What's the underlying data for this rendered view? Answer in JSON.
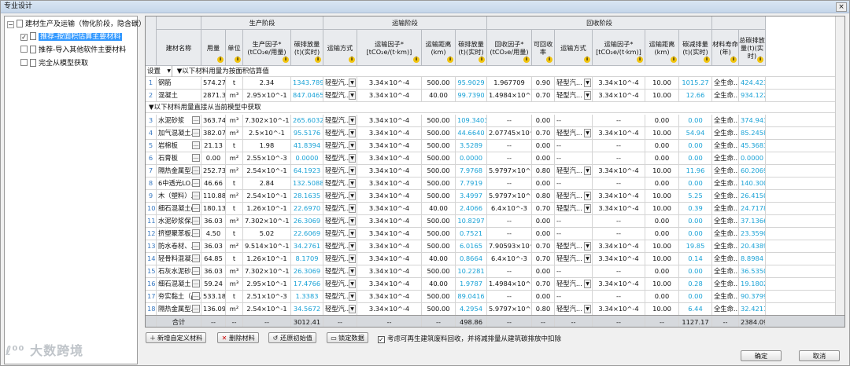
{
  "window": {
    "title": "专业设计",
    "close": "×"
  },
  "tree": {
    "root": "建材生产及运输（物化阶段，隐含碳）",
    "items": [
      {
        "label": "推荐-按面积估算主要材料",
        "checked": true,
        "selected": true
      },
      {
        "label": "推荐-导入其他软件主要材料",
        "checked": false,
        "selected": false
      },
      {
        "label": "完全从模型获取",
        "checked": false,
        "selected": false
      }
    ]
  },
  "header": {
    "groups": {
      "production": "生产阶段",
      "transport": "运输阶段",
      "recycle": "回收阶段"
    },
    "columns": [
      "建材名称",
      "用量",
      "单位",
      "生产因子*(tCO₂e/用量)",
      "碳排放量(t)(实时)",
      "运输方式",
      "运输因子*[tCO₂e/(t·km)]",
      "运输距离(km)",
      "碳排放量(t)(实时)",
      "回收因子*(tCO₂e/用量)",
      "可回收率",
      "运输方式",
      "运输因子*[tCO₂e/(t·km)]",
      "运输距离(km)",
      "碳减排量(t)(实时)",
      "材料寿命(年)",
      "总碳排放量(t)(实时)"
    ]
  },
  "group1": {
    "settings": "设置",
    "label": "以下材料用量为按面积估算值"
  },
  "group2": {
    "label": "以下材料用量直接从当前模型中获取"
  },
  "rows": [
    [
      "1",
      "钢筋",
      "574.27",
      "t",
      "2.34",
      "1343.7890",
      "轻型汽...",
      "3.34×10^-4",
      "500.00",
      "95.9029",
      "1.967709",
      "0.90",
      "轻型汽...",
      "3.34×10^-4",
      "10.00",
      "1015.27",
      "全生命...",
      "424.4234"
    ],
    [
      "2",
      "混凝土",
      "2871.34",
      "m³",
      "2.95×10^-1",
      "847.0465",
      "轻型汽...",
      "3.34×10^-4",
      "40.00",
      "99.7390",
      "1.4984×10^-2",
      "0.70",
      "轻型汽...",
      "3.34×10^-4",
      "10.00",
      "12.66",
      "全生命...",
      "934.1226"
    ],
    [
      "3",
      "水泥砂浆",
      "363.74",
      "m³",
      "7.302×10^-1",
      "265.6032",
      "轻型汽...",
      "3.34×10^-4",
      "500.00",
      "109.3403",
      "--",
      "0.00",
      "--",
      "--",
      "0.00",
      "0.00",
      "全生命...",
      "374.9435"
    ],
    [
      "4",
      "加气混凝土...",
      "382.07",
      "m³",
      "2.5×10^-1",
      "95.5176",
      "轻型汽...",
      "3.34×10^-4",
      "500.00",
      "44.6640",
      "2.07745×10^-1",
      "0.70",
      "轻型汽...",
      "3.34×10^-4",
      "10.00",
      "54.94",
      "全生命...",
      "85.2458"
    ],
    [
      "5",
      "岩棉板",
      "21.13",
      "t",
      "1.98",
      "41.8394",
      "轻型汽...",
      "3.34×10^-4",
      "500.00",
      "3.5289",
      "--",
      "0.00",
      "--",
      "--",
      "0.00",
      "0.00",
      "全生命...",
      "45.3683"
    ],
    [
      "6",
      "石膏板",
      "0.00",
      "m²",
      "2.55×10^-3",
      "0.0000",
      "轻型汽...",
      "3.34×10^-4",
      "500.00",
      "0.0000",
      "--",
      "0.00",
      "--",
      "--",
      "0.00",
      "0.00",
      "全生命...",
      "0.0000"
    ],
    [
      "7",
      "隔热金属型...",
      "252.73",
      "m²",
      "2.54×10^-1",
      "64.1923",
      "轻型汽...",
      "3.34×10^-4",
      "500.00",
      "7.9768",
      "5.9797×10^-2",
      "0.80",
      "轻型汽...",
      "3.34×10^-4",
      "10.00",
      "11.96",
      "全生命...",
      "60.2069"
    ],
    [
      "8",
      "6中透光LO...",
      "46.66",
      "t",
      "2.84",
      "132.5088",
      "轻型汽...",
      "3.34×10^-4",
      "500.00",
      "7.7919",
      "--",
      "0.00",
      "--",
      "--",
      "0.00",
      "0.00",
      "全生命...",
      "140.3006"
    ],
    [
      "9",
      "木（塑料）...",
      "110.88",
      "m²",
      "2.54×10^-1",
      "28.1635",
      "轻型汽...",
      "3.34×10^-4",
      "500.00",
      "3.4997",
      "5.9797×10^-2",
      "0.80",
      "轻型汽...",
      "3.34×10^-4",
      "10.00",
      "5.25",
      "全生命...",
      "26.4150"
    ],
    [
      "10",
      "细石混凝土(...",
      "180.13",
      "t",
      "1.26×10^-1",
      "22.6970",
      "轻型汽...",
      "3.34×10^-4",
      "40.00",
      "2.4066",
      "6.4×10^-3",
      "0.70",
      "轻型汽...",
      "3.34×10^-4",
      "10.00",
      "0.39",
      "全生命...",
      "24.7178"
    ],
    [
      "11",
      "水泥砂浆保...",
      "36.03",
      "m³",
      "7.302×10^-1",
      "26.3069",
      "轻型汽...",
      "3.34×10^-4",
      "500.00",
      "10.8297",
      "--",
      "0.00",
      "--",
      "--",
      "0.00",
      "0.00",
      "全生命...",
      "37.1366"
    ],
    [
      "12",
      "挤塑聚苯板...",
      "4.50",
      "t",
      "5.02",
      "22.6069",
      "轻型汽...",
      "3.34×10^-4",
      "500.00",
      "0.7521",
      "--",
      "0.00",
      "--",
      "--",
      "0.00",
      "0.00",
      "全生命...",
      "23.3590"
    ],
    [
      "13",
      "防水卷材、...",
      "36.03",
      "m²",
      "9.514×10^-1",
      "34.2761",
      "轻型汽...",
      "3.34×10^-4",
      "500.00",
      "6.0165",
      "7.90593×10^-1",
      "0.70",
      "轻型汽...",
      "3.34×10^-4",
      "10.00",
      "19.85",
      "全生命...",
      "20.4389"
    ],
    [
      "14",
      "轻骨料混凝...",
      "64.85",
      "t",
      "1.26×10^-1",
      "8.1709",
      "轻型汽...",
      "3.34×10^-4",
      "40.00",
      "0.8664",
      "6.4×10^-3",
      "0.70",
      "轻型汽...",
      "3.34×10^-4",
      "10.00",
      "0.14",
      "全生命...",
      "8.8984"
    ],
    [
      "15",
      "石灰水泥砂...",
      "36.03",
      "m³",
      "7.302×10^-1",
      "26.3069",
      "轻型汽...",
      "3.34×10^-4",
      "500.00",
      "10.2281",
      "--",
      "0.00",
      "--",
      "--",
      "0.00",
      "0.00",
      "全生命...",
      "36.5350"
    ],
    [
      "16",
      "细石混凝土",
      "59.24",
      "m³",
      "2.95×10^-1",
      "17.4766",
      "轻型汽...",
      "3.34×10^-4",
      "40.00",
      "1.9787",
      "1.4984×10^-2",
      "0.70",
      "轻型汽...",
      "3.34×10^-4",
      "10.00",
      "0.28",
      "全生命...",
      "19.1802"
    ],
    [
      "17",
      "夯实黏土（ρ...",
      "533.18",
      "t",
      "2.51×10^-3",
      "1.3383",
      "轻型汽...",
      "3.34×10^-4",
      "500.00",
      "89.0416",
      "--",
      "0.00",
      "--",
      "--",
      "0.00",
      "0.00",
      "全生命...",
      "90.3799"
    ],
    [
      "18",
      "隔热金属型...",
      "136.09",
      "m²",
      "2.54×10^-1",
      "34.5672",
      "轻型汽...",
      "3.34×10^-4",
      "500.00",
      "4.2954",
      "5.9797×10^-2",
      "0.80",
      "轻型汽...",
      "3.34×10^-4",
      "10.00",
      "6.44",
      "全生命...",
      "32.4211"
    ]
  ],
  "summary": {
    "label": "合计",
    "dash": "--",
    "prod_total": "3012.41",
    "trans_total": "498.86",
    "reduce_total": "1127.17",
    "grand_total": "2384.09"
  },
  "buttons": {
    "add": "新增自定义材料",
    "delete": "删除材料",
    "restore": "还原初始值",
    "lock": "锁定数据",
    "ok": "确定",
    "cancel": "取消"
  },
  "option": {
    "checked": true,
    "label": "考虑可再生建筑废料回收，并将减排量从建筑碳排放中扣除"
  },
  "logo": "大数跨境"
}
